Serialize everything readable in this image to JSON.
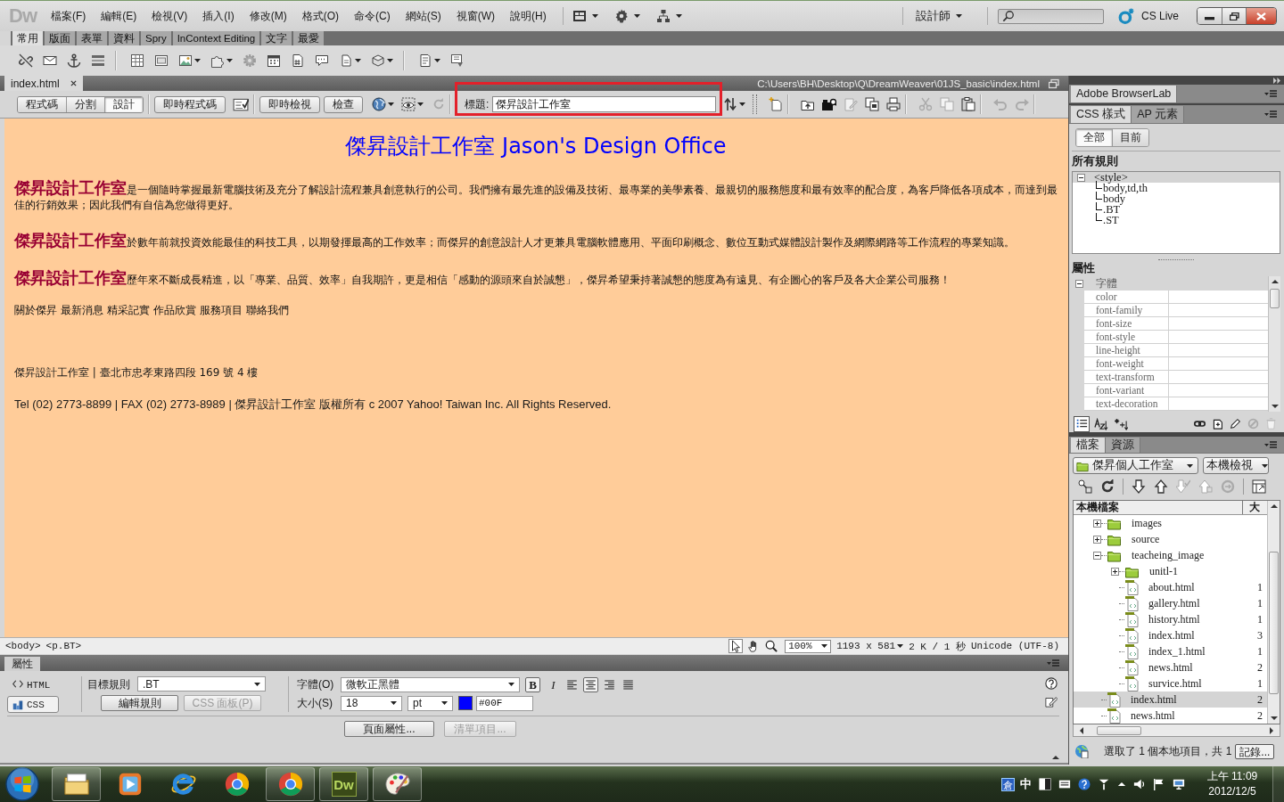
{
  "title_bar": {
    "logo": "Dw",
    "menus": [
      "檔案(F)",
      "編輯(E)",
      "檢視(V)",
      "插入(I)",
      "修改(M)",
      "格式(O)",
      "命令(C)",
      "網站(S)",
      "視窗(W)",
      "說明(H)"
    ],
    "workspace": "設計師",
    "cs_live": "CS Live"
  },
  "insert_bar": {
    "tabs": [
      {
        "label": "常用",
        "selected": true
      },
      {
        "label": "版面",
        "selected": false
      },
      {
        "label": "表單",
        "selected": false
      },
      {
        "label": "資料",
        "selected": false
      },
      {
        "label": "Spry",
        "selected": false
      },
      {
        "label": "InContext Editing",
        "selected": false
      },
      {
        "label": "文字",
        "selected": false
      },
      {
        "label": "最愛",
        "selected": false
      }
    ]
  },
  "document": {
    "tab": "index.html",
    "path": "C:\\Users\\BH\\Desktop\\Q\\DreamWeaver\\01JS_basic\\index.html",
    "view_buttons": [
      {
        "label": "程式碼",
        "selected": false
      },
      {
        "label": "分割",
        "selected": false
      },
      {
        "label": "設計",
        "selected": true
      }
    ],
    "live_code": "即時程式碼",
    "live_view": "即時檢視",
    "inspect": "檢查",
    "title_field": {
      "label": "標題:",
      "value": "傑昇設計工作室",
      "highlighted": true
    }
  },
  "page": {
    "heading": "傑昇設計工作室 Jason's Design Office",
    "paragraphs": [
      {
        "lead": "傑昇設計工作室",
        "text": "是一個隨時掌握最新電腦技術及充分了解設計流程兼具創意執行的公司。我們擁有最先進的設備及技術、最專業的美學素養、最親切的服務態度和最有效率的配合度，為客戶降低各項成本，而達到最佳的行銷效果；因此我們有自信為您做得更好。"
      },
      {
        "lead": "傑昇設計工作室",
        "text": "於數年前就投資效能最佳的科技工具，以期發揮最高的工作效率；而傑昇的創意設計人才更兼具電腦軟體應用、平面印刷概念、數位互動式媒體設計製作及網際網路等工作流程的專業知識。"
      },
      {
        "lead": "傑昇設計工作室",
        "text": "歷年來不斷成長精進，以「專業、品質、效率」自我期許，更是相信「感動的源頭來自於誠懇」，傑昇希望秉持著誠懇的態度為有遠見、有企圖心的客戶及各大企業公司服務！"
      }
    ],
    "nav_links": [
      "關於傑昇",
      "最新消息",
      "精采記實",
      "作品欣賞",
      "服務項目",
      "聯絡我們"
    ],
    "footer_lines": [
      "傑昇設計工作室 | 臺北市忠孝東路四段 169 號 4 樓",
      "Tel (02) 2773-8899 | FAX (02) 2773-8989 | 傑昇設計工作室 版權所有 c 2007 Yahoo! Taiwan Inc. All Rights Reserved."
    ]
  },
  "status_bar": {
    "tags": [
      "<body>",
      "<p.BT>"
    ],
    "zoom": "100%",
    "dimensions": "1193 x 581",
    "download": "2 K / 1 秒",
    "encoding": "Unicode (UTF-8)"
  },
  "properties": {
    "title": "屬性",
    "modes": [
      {
        "label": "HTML",
        "selected": false
      },
      {
        "label": "CSS",
        "selected": true
      }
    ],
    "target_rule_label": "目標規則",
    "target_rule": ".BT",
    "edit_rule": {
      "label": "編輯規則",
      "disabled": false
    },
    "css_panel": {
      "label": "CSS 面板(P)",
      "disabled": true
    },
    "font_label": "字體(O)",
    "font": "微軟正黑體",
    "bold": {
      "label": "B",
      "selected": true
    },
    "italic": {
      "label": "I",
      "selected": false
    },
    "alignments": [
      {
        "kind": "left",
        "selected": false
      },
      {
        "kind": "center",
        "selected": true
      },
      {
        "kind": "right",
        "selected": false
      },
      {
        "kind": "justify",
        "selected": false
      }
    ],
    "size_label": "大小(S)",
    "size": "18",
    "unit": "pt",
    "color": "#0000ff",
    "color_value": "#00F",
    "page_properties": {
      "label": "頁面屬性...",
      "disabled": false
    },
    "list_item": {
      "label": "清單項目...",
      "disabled": true
    }
  },
  "panels": {
    "browserlab": {
      "tab": "Adobe BrowserLab"
    },
    "css_styles": {
      "tabs": [
        {
          "label": "CSS 樣式",
          "selected": true
        },
        {
          "label": "AP 元素",
          "selected": false
        }
      ],
      "modes": [
        {
          "label": "全部",
          "selected": true
        },
        {
          "label": "目前",
          "selected": false
        }
      ],
      "rules_heading": "所有規則",
      "rules": [
        {
          "name": "<style>",
          "expanded": true,
          "selected": true,
          "children": [
            {
              "name": "body,td,th",
              "selected": false
            },
            {
              "name": "body",
              "selected": false
            },
            {
              "name": ".BT",
              "selected": false
            },
            {
              "name": ".ST",
              "selected": false
            }
          ]
        }
      ],
      "properties_heading": "屬性",
      "property_group": {
        "name": "字體",
        "expanded": true,
        "properties": [
          "color",
          "font-family",
          "font-size",
          "font-style",
          "line-height",
          "font-weight",
          "text-transform",
          "font-variant",
          "text-decoration"
        ]
      }
    },
    "files": {
      "tabs": [
        {
          "label": "檔案",
          "selected": true
        },
        {
          "label": "資源",
          "selected": false
        }
      ],
      "site": "傑昇個人工作室",
      "view": "本機檢視",
      "columns": [
        "本機檔案",
        "大"
      ],
      "tree": [
        {
          "name": "images",
          "kind": "folder",
          "expanded": false,
          "selected": false
        },
        {
          "name": "source",
          "kind": "folder",
          "expanded": false,
          "selected": false
        },
        {
          "name": "teacheing_image",
          "kind": "folder",
          "expanded": true,
          "selected": false,
          "children": [
            {
              "name": "unitl-1",
              "kind": "folder",
              "expanded": false,
              "selected": false
            },
            {
              "name": "about.html",
              "kind": "file",
              "size": "1",
              "selected": false
            },
            {
              "name": "gallery.html",
              "kind": "file",
              "size": "1",
              "selected": false
            },
            {
              "name": "history.html",
              "kind": "file",
              "size": "1",
              "selected": false
            },
            {
              "name": "index.html",
              "kind": "file",
              "size": "3",
              "selected": false
            },
            {
              "name": "index_1.html",
              "kind": "file",
              "size": "1",
              "selected": false
            },
            {
              "name": "news.html",
              "kind": "file",
              "size": "2",
              "selected": false
            },
            {
              "name": "survice.html",
              "kind": "file",
              "size": "1",
              "selected": false
            }
          ]
        },
        {
          "name": "index.html",
          "kind": "file",
          "size": "2",
          "selected": true
        },
        {
          "name": "news.html",
          "kind": "file",
          "size": "2",
          "selected": false
        }
      ],
      "status": "選取了 1 個本地項目，共 1",
      "log_button": "記錄..."
    }
  },
  "taskbar": {
    "apps": [
      {
        "kind": "explorer",
        "running": true
      },
      {
        "kind": "media",
        "running": false
      },
      {
        "kind": "ie",
        "running": false
      },
      {
        "kind": "chrome",
        "running": false
      },
      {
        "kind": "chrome",
        "running": true
      },
      {
        "kind": "dw",
        "label": "Dw",
        "running": true
      },
      {
        "kind": "paint",
        "running": true
      }
    ],
    "ime": {
      "mode": "倉",
      "language": "中"
    },
    "clock": {
      "time": "上午 11:09",
      "date": "2012/12/5"
    }
  }
}
